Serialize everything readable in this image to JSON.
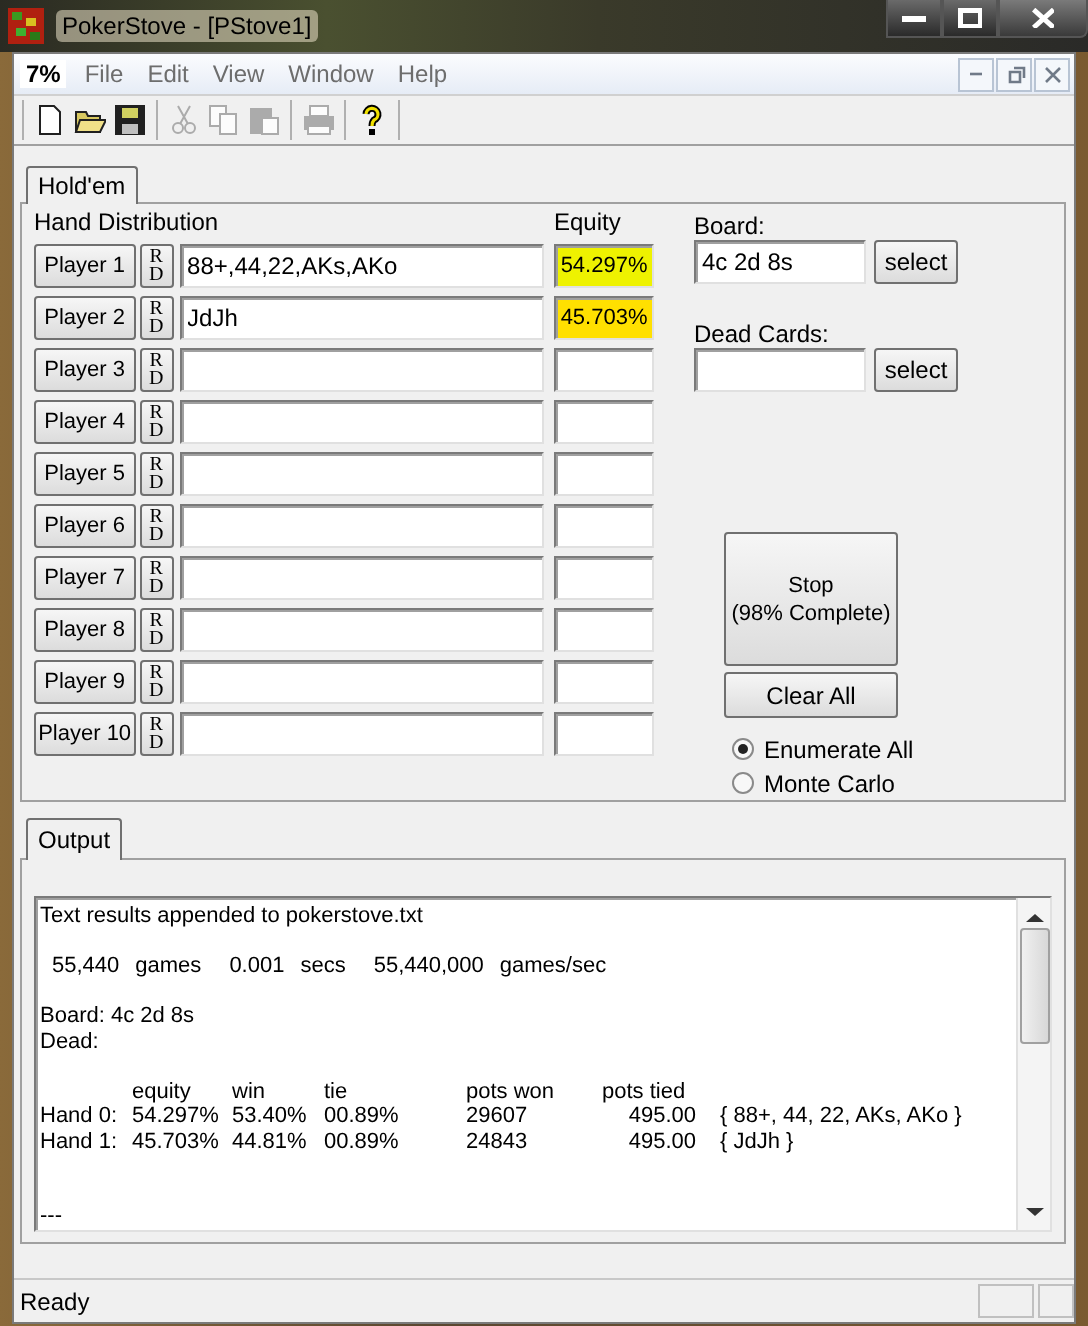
{
  "window": {
    "title": "PokerStove - [PStove1]"
  },
  "menu": {
    "app_label": "7%",
    "items": [
      "File",
      "Edit",
      "View",
      "Window",
      "Help"
    ]
  },
  "toolbar": [
    [
      {
        "kind": "new",
        "disabled": false
      },
      {
        "kind": "open",
        "disabled": false
      },
      {
        "kind": "save",
        "disabled": false
      }
    ],
    [
      {
        "kind": "cut",
        "disabled": true
      },
      {
        "kind": "copy",
        "disabled": true
      },
      {
        "kind": "paste",
        "disabled": true
      }
    ],
    [
      {
        "kind": "print",
        "disabled": true
      }
    ],
    [
      {
        "kind": "help",
        "disabled": false
      }
    ]
  ],
  "tabs": [
    {
      "label": "Hold'em",
      "selected": true
    }
  ],
  "hand_distribution": {
    "heading": "Hand Distribution",
    "equity_heading": "Equity"
  },
  "players": [
    {
      "label": "Player 1",
      "rd": [
        "R",
        "D"
      ],
      "hand": "88+,44,22,AKs,AKo",
      "equity": "54.297%",
      "color": "#eef200"
    },
    {
      "label": "Player 2",
      "rd": [
        "R",
        "D"
      ],
      "hand": "JdJh",
      "equity": "45.703%",
      "color": "#ffe000"
    },
    {
      "label": "Player 3",
      "rd": [
        "R",
        "D"
      ]
    },
    {
      "label": "Player 4",
      "rd": [
        "R",
        "D"
      ]
    },
    {
      "label": "Player 5",
      "rd": [
        "R",
        "D"
      ]
    },
    {
      "label": "Player 6",
      "rd": [
        "R",
        "D"
      ]
    },
    {
      "label": "Player 7",
      "rd": [
        "R",
        "D"
      ]
    },
    {
      "label": "Player 8",
      "rd": [
        "R",
        "D"
      ]
    },
    {
      "label": "Player 9",
      "rd": [
        "R",
        "D"
      ]
    },
    {
      "label": "Player 10",
      "rd": [
        "R",
        "D"
      ]
    }
  ],
  "board": {
    "label": "Board:",
    "value": "4c 2d 8s",
    "button": "select"
  },
  "dead_cards": {
    "label": "Dead Cards:",
    "button": "select"
  },
  "stop_button": [
    "Stop",
    "(98% Complete)"
  ],
  "clear_button": "Clear All",
  "modes": [
    {
      "label": "Enumerate All",
      "selected": true
    },
    {
      "label": "Monte Carlo",
      "selected": false
    }
  ],
  "output_tabs": [
    {
      "label": "Output",
      "selected": true
    }
  ],
  "output": {
    "notice": "Text results appended to pokerstove.txt",
    "stats": [
      {
        "value": "55,440",
        "unit": "games"
      },
      {
        "value": "0.001",
        "unit": "secs"
      },
      {
        "value": "55,440,000",
        "unit": "games/sec"
      }
    ],
    "board_line": "Board: 4c 2d 8s",
    "dead_line": "Dead:",
    "columns": [
      "equity",
      "win",
      "tie",
      "pots won",
      "pots tied"
    ],
    "rows": [
      {
        "hand": "Hand 0:",
        "cells": [
          "54.297%",
          "53.40%",
          "00.89%",
          "29607",
          "495.00",
          "{ 88+, 44, 22, AKs, AKo }"
        ]
      },
      {
        "hand": "Hand 1:",
        "cells": [
          "45.703%",
          "44.81%",
          "00.89%",
          "24843",
          "495.00",
          "{ JdJh }"
        ]
      }
    ],
    "separator": "---"
  },
  "status_bar": {
    "text": "Ready"
  }
}
